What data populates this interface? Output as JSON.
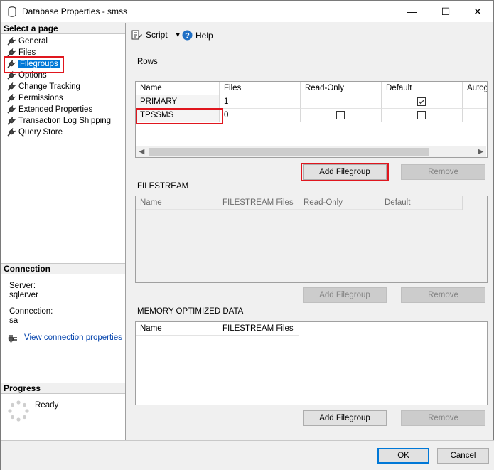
{
  "window": {
    "title": "Database Properties - smss",
    "min": "—",
    "max": "☐",
    "close": "✕"
  },
  "left": {
    "select_header": "Select a page",
    "nav": [
      {
        "label": "General"
      },
      {
        "label": "Files"
      },
      {
        "label": "Filegroups"
      },
      {
        "label": "Options"
      },
      {
        "label": "Change Tracking"
      },
      {
        "label": "Permissions"
      },
      {
        "label": "Extended Properties"
      },
      {
        "label": "Transaction Log Shipping"
      },
      {
        "label": "Query Store"
      }
    ],
    "selected_index": 2,
    "connection_header": "Connection",
    "server_label": "Server:",
    "server_value": "sqlerver",
    "connection_label": "Connection:",
    "connection_value": "sa",
    "view_props_link": "View connection properties",
    "progress_header": "Progress",
    "progress_status": "Ready"
  },
  "toolbar": {
    "script_label": "Script",
    "help_label": "Help"
  },
  "rows": {
    "label": "Rows",
    "columns": [
      "Name",
      "Files",
      "Read-Only",
      "Default",
      "Autog"
    ],
    "items": [
      {
        "name": "PRIMARY",
        "files": "1",
        "read_only": false,
        "default": true
      },
      {
        "name": "TPSSMS",
        "files": "0",
        "read_only": false,
        "default": false
      }
    ],
    "add_button": "Add Filegroup",
    "remove_button": "Remove"
  },
  "filestream": {
    "label": "FILESTREAM",
    "columns": [
      "Name",
      "FILESTREAM Files",
      "Read-Only",
      "Default"
    ],
    "add_button": "Add Filegroup",
    "remove_button": "Remove"
  },
  "memory": {
    "label": "MEMORY OPTIMIZED DATA",
    "columns": [
      "Name",
      "FILESTREAM Files"
    ],
    "add_button": "Add Filegroup",
    "remove_button": "Remove"
  },
  "footer": {
    "ok": "OK",
    "cancel": "Cancel"
  },
  "colors": {
    "highlight": "#e0161e",
    "selection": "#0078d7",
    "link": "#0645ad"
  }
}
